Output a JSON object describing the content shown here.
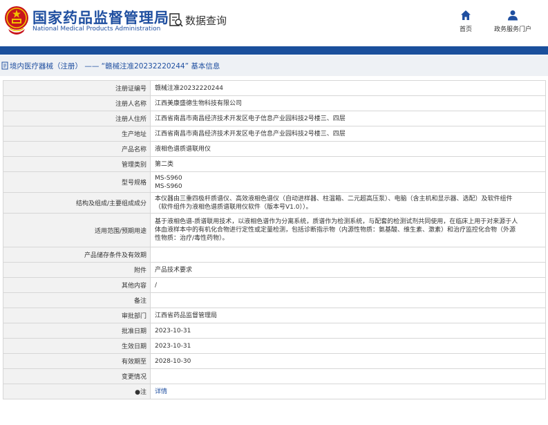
{
  "header": {
    "site_title_cn": "国家药品监督管理局",
    "site_title_en": "National Medical Products Administration",
    "query_label": "数据查询",
    "brand_color": "#1f4fa0",
    "bar_color": "#1a4f9c"
  },
  "nav": [
    {
      "label": "首页",
      "icon": "home-icon"
    },
    {
      "label": "政务服务门户",
      "icon": "user-icon"
    }
  ],
  "breadcrumb": {
    "text": "境内医疗器械（注册） —— “赣械注准20232220244” 基本信息",
    "icon": "document-icon"
  },
  "table": {
    "rows": [
      {
        "label": "注册证编号",
        "lines": [
          "赣械注准20232220244"
        ]
      },
      {
        "label": "注册人名称",
        "lines": [
          "江西美康盛德生物科技有限公司"
        ]
      },
      {
        "label": "注册人住所",
        "lines": [
          "江西省南昌市南昌经济技术开发区电子信息产业园科技2号楼三、四层"
        ]
      },
      {
        "label": "生产地址",
        "lines": [
          "江西省南昌市南昌经济技术开发区电子信息产业园科技2号楼三、四层"
        ]
      },
      {
        "label": "产品名称",
        "lines": [
          "液相色谱质谱联用仪"
        ]
      },
      {
        "label": "管理类别",
        "lines": [
          "第二类"
        ]
      },
      {
        "label": "型号规格",
        "lines": [
          "MS-S960",
          "MS-S960"
        ]
      },
      {
        "label": "结构及组成/主要组成成分",
        "lines": [
          "本仪器由三重四极杆质谱仪、高效液相色谱仪（自动进样器、柱温箱、二元超高压泵）、电脑（含主机和显示器、选配）及软件组件",
          "（软件组件为液相色谱质谱联用仪软件（版本号V1.0））。"
        ]
      },
      {
        "label": "适用范围/预期用途",
        "lines": [
          "基于液相色谱-质谱联用技术，以液相色谱作为分离系统，质谱作为检测系统，与配套的检测试剂共同使用，在临床上用于对来源于人",
          "体血液样本中的有机化合物进行定性或定量检测，包括诊断指示物（内源性物质：氨基酸、维生素、激素）和治疗监控化合物（外源",
          "性物质：治疗/毒性药物）。"
        ]
      },
      {
        "label": "产品储存条件及有效期",
        "lines": [
          ""
        ]
      },
      {
        "label": "附件",
        "lines": [
          "产品技术要求"
        ]
      },
      {
        "label": "其他内容",
        "lines": [
          "/"
        ]
      },
      {
        "label": "备注",
        "lines": [
          ""
        ]
      },
      {
        "label": "审批部门",
        "lines": [
          "江西省药品监督管理局"
        ]
      },
      {
        "label": "批准日期",
        "lines": [
          "2023-10-31"
        ]
      },
      {
        "label": "生效日期",
        "lines": [
          "2023-10-31"
        ]
      },
      {
        "label": "有效期至",
        "lines": [
          "2028-10-30"
        ]
      },
      {
        "label": "变更情况",
        "lines": [
          ""
        ]
      },
      {
        "label": "●注",
        "lines": [
          "详情"
        ],
        "link": true
      }
    ]
  }
}
